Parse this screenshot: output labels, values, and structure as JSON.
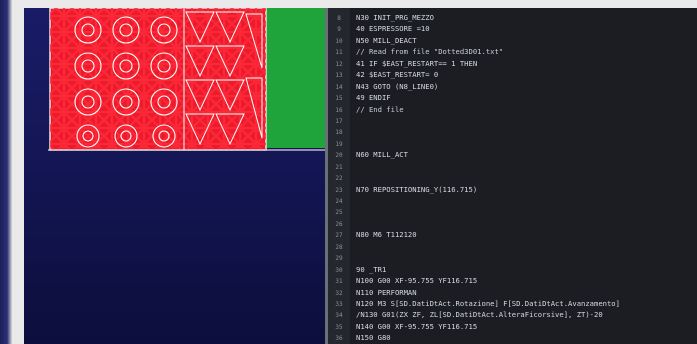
{
  "colors": {
    "viewport_bg": "#161860",
    "workpiece_green": "#1fa33b",
    "part_red": "#e2192c",
    "part_edge": "#f2f2f2",
    "editor_bg": "#1b1d22",
    "code_text": "#d6dbe2"
  },
  "viewport": {
    "description_icons": [
      "cad-sheet-layout",
      "circular-hole-icon"
    ]
  },
  "editor": {
    "lines": [
      {
        "num": "8",
        "text": "N30 INIT_PRG_MEZZO"
      },
      {
        "num": "9",
        "text": "40 ESPRESSORE =10"
      },
      {
        "num": "10",
        "text": "N50 MILL_DEACT"
      },
      {
        "num": "11",
        "text": "// Read from file \"Dotted3D01.txt\""
      },
      {
        "num": "12",
        "text": "41 IF $EAST_RESTART== 1 THEN"
      },
      {
        "num": "13",
        "text": "42 $EAST_RESTART= 0"
      },
      {
        "num": "14",
        "text": "N43 GOTO (N8_LINE0)"
      },
      {
        "num": "15",
        "text": "49 ENDIF"
      },
      {
        "num": "16",
        "text": "// End file"
      },
      {
        "num": "17",
        "text": ""
      },
      {
        "num": "18",
        "text": ""
      },
      {
        "num": "19",
        "text": ""
      },
      {
        "num": "20",
        "text": "N60 MILL_ACT"
      },
      {
        "num": "21",
        "text": ""
      },
      {
        "num": "22",
        "text": ""
      },
      {
        "num": "23",
        "text": "N70 REPOSITIONING_Y(116.715)"
      },
      {
        "num": "24",
        "text": ""
      },
      {
        "num": "25",
        "text": ""
      },
      {
        "num": "26",
        "text": ""
      },
      {
        "num": "27",
        "text": "N80 M6 T112120"
      },
      {
        "num": "28",
        "text": ""
      },
      {
        "num": "29",
        "text": ""
      },
      {
        "num": "30",
        "text": "90 _TR1"
      },
      {
        "num": "31",
        "text": "N100 G00 XF-95.755 YF116.715"
      },
      {
        "num": "32",
        "text": "N110 PERFORMAN"
      },
      {
        "num": "33",
        "text": "N120 M3 S[SD.DatiDtAct.Rotazione] F[SD.DatiDtAct.Avanzamento]"
      },
      {
        "num": "34",
        "text": "/N130 G01(ZX ZF, ZL[SD.DatiDtAct.AlteraFicorsive], ZT)-20"
      },
      {
        "num": "35",
        "text": "N140 G00 XF-95.755 YF116.715"
      },
      {
        "num": "36",
        "text": "N150 G80"
      }
    ]
  }
}
